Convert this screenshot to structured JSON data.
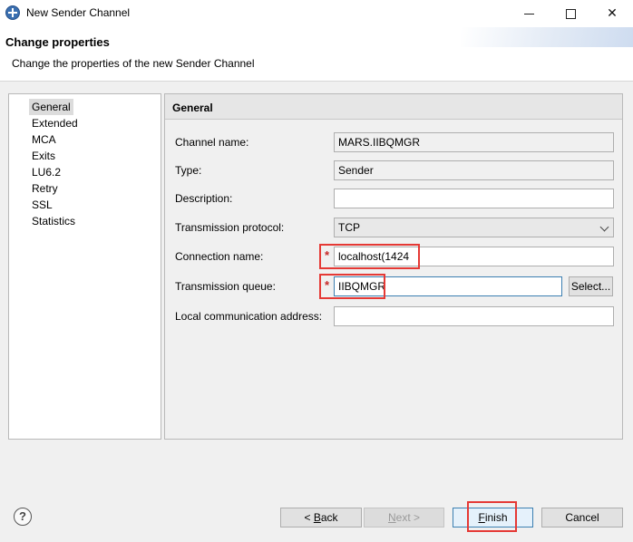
{
  "window": {
    "title": "New Sender Channel",
    "minimize_icon": "minimize-icon",
    "maximize_icon": "maximize-icon",
    "close_icon": "close-icon",
    "close_glyph": "✕"
  },
  "header": {
    "title": "Change properties",
    "subtitle": "Change the properties of the new Sender Channel"
  },
  "nav": {
    "items": [
      {
        "label": "General",
        "selected": true
      },
      {
        "label": "Extended",
        "selected": false
      },
      {
        "label": "MCA",
        "selected": false
      },
      {
        "label": "Exits",
        "selected": false
      },
      {
        "label": "LU6.2",
        "selected": false
      },
      {
        "label": "Retry",
        "selected": false
      },
      {
        "label": "SSL",
        "selected": false
      },
      {
        "label": "Statistics",
        "selected": false
      }
    ]
  },
  "panel": {
    "title": "General",
    "fields": {
      "channel_name": {
        "label": "Channel name:",
        "value": "MARS.IIBQMGR"
      },
      "type": {
        "label": "Type:",
        "value": "Sender"
      },
      "description": {
        "label": "Description:",
        "value": ""
      },
      "transmission_protocol": {
        "label": "Transmission protocol:",
        "value": "TCP"
      },
      "connection_name": {
        "label": "Connection name:",
        "value": "localhost(1424",
        "required_marker": "*"
      },
      "transmission_queue": {
        "label": "Transmission queue:",
        "value": "IIBQMGR",
        "required_marker": "*"
      },
      "local_communication_address": {
        "label": "Local communication address:",
        "value": ""
      }
    },
    "select_button": "Select..."
  },
  "buttons": {
    "help": "?",
    "back_prefix": "< ",
    "back_mnemonic": "B",
    "back_rest": "ack",
    "next_mnemonic": "N",
    "next_rest": "ext >",
    "finish_mnemonic": "F",
    "finish_rest": "inish",
    "cancel": "Cancel"
  },
  "colors": {
    "highlight": "#e53935",
    "required": "#c62828",
    "focus": "#3c7fb1"
  }
}
